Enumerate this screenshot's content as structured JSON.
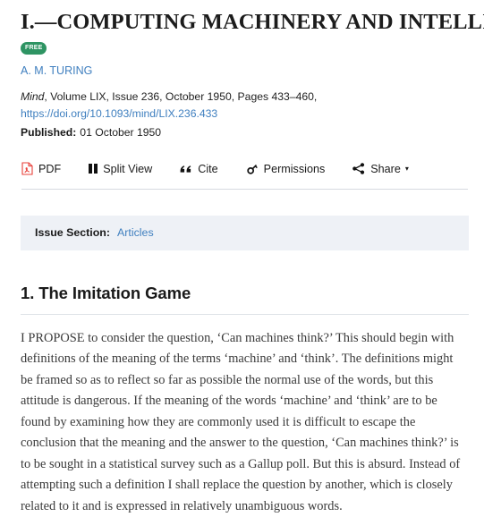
{
  "article": {
    "title": "I.—COMPUTING MACHINERY AND INTELLIGENCE",
    "access_badge": "FREE",
    "author": "A. M. TURING",
    "citation_journal": "Mind",
    "citation_rest": ", Volume LIX, Issue 236, October 1950, Pages 433–460,",
    "doi_url": "https://doi.org/10.1093/mind/LIX.236.433",
    "published_label": "Published:",
    "published_value": "01 October 1950"
  },
  "toolbar": {
    "items": [
      {
        "label": "PDF",
        "icon": "pdf-icon",
        "caret": false
      },
      {
        "label": "Split View",
        "icon": "split-view-icon",
        "caret": false
      },
      {
        "label": "Cite",
        "icon": "quote-icon",
        "caret": false
      },
      {
        "label": "Permissions",
        "icon": "key-icon",
        "caret": false
      },
      {
        "label": "Share",
        "icon": "share-icon",
        "caret": true
      }
    ],
    "share_caret": "▾"
  },
  "issue_section": {
    "label": "Issue Section:",
    "value": "Articles"
  },
  "content": {
    "section_heading": "1. The Imitation Game",
    "paragraph_lead": "I PROPOSE",
    "paragraph_rest": " to consider the question, ‘Can machines think?’ This should begin with definitions of the meaning of the terms ‘machine’ and ‘think’. The definitions might be framed so as to reflect so far as possible the normal use of the words, but this attitude is dangerous. If the meaning of the words ‘machine’ and ‘think’ are to be found by examining how they are commonly used it is difficult to escape the conclusion that the meaning and the answer to the question, ‘Can machines think?’ is to be sought in a statistical survey such as a Gallup poll. But this is absurd. Instead of attempting such a definition I shall replace the question by another, which is closely related to it and is expressed in relatively unambiguous words."
  },
  "colors": {
    "link": "#3f7fbf",
    "badge_green": "#2e9463",
    "panel_bg": "#eef1f6",
    "pdf_red": "#e8403a"
  }
}
